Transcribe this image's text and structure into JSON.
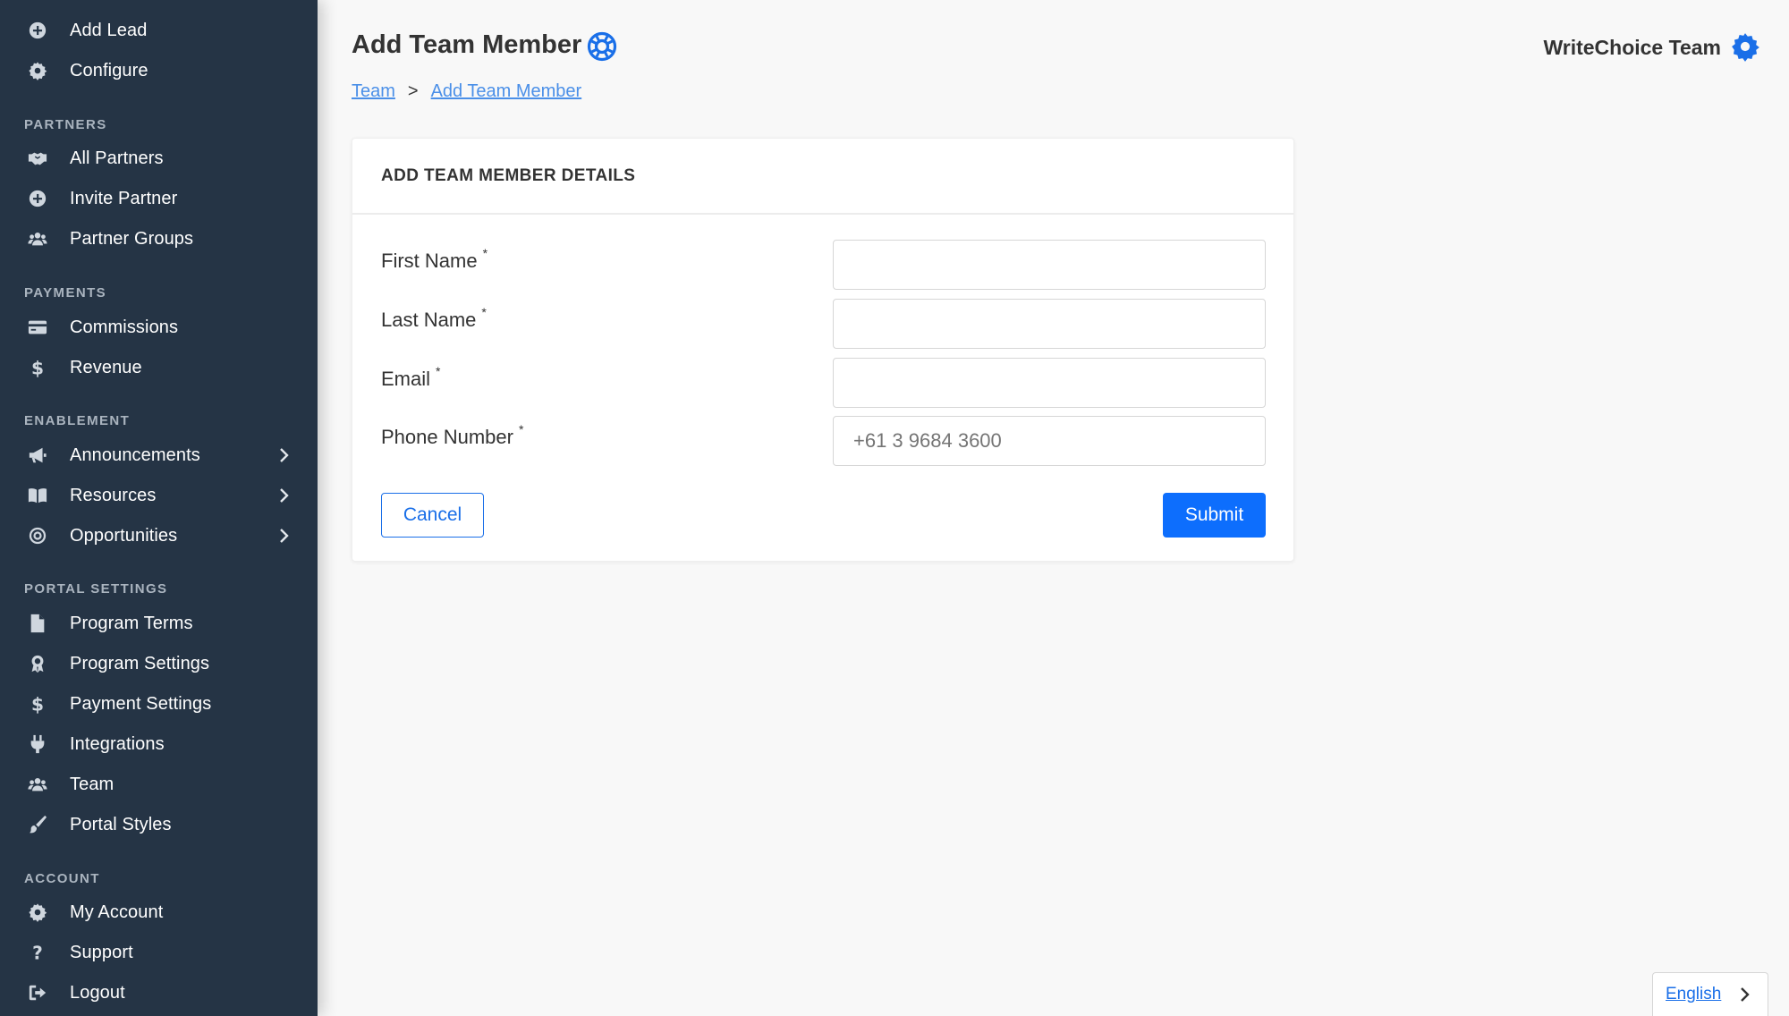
{
  "sidebar": {
    "top_items": [
      {
        "label": "Add Lead",
        "icon": "plus-circle-icon"
      },
      {
        "label": "Configure",
        "icon": "gear-icon"
      }
    ],
    "sections": {
      "partners": {
        "title": "PARTNERS",
        "items": [
          {
            "label": "All Partners",
            "icon": "handshake-icon"
          },
          {
            "label": "Invite Partner",
            "icon": "plus-circle-icon"
          },
          {
            "label": "Partner Groups",
            "icon": "users-icon"
          }
        ]
      },
      "payments": {
        "title": "PAYMENTS",
        "items": [
          {
            "label": "Commissions",
            "icon": "credit-card-icon"
          },
          {
            "label": "Revenue",
            "icon": "dollar-icon"
          }
        ]
      },
      "enablement": {
        "title": "ENABLEMENT",
        "items": [
          {
            "label": "Announcements",
            "icon": "megaphone-icon"
          },
          {
            "label": "Resources",
            "icon": "book-icon"
          },
          {
            "label": "Opportunities",
            "icon": "target-icon"
          }
        ]
      },
      "portal_settings": {
        "title": "PORTAL SETTINGS",
        "items": [
          {
            "label": "Program Terms",
            "icon": "file-icon"
          },
          {
            "label": "Program Settings",
            "icon": "award-icon"
          },
          {
            "label": "Payment Settings",
            "icon": "dollar-icon"
          },
          {
            "label": "Integrations",
            "icon": "plug-icon"
          },
          {
            "label": "Team",
            "icon": "users-icon"
          },
          {
            "label": "Portal Styles",
            "icon": "brush-icon"
          }
        ]
      },
      "account": {
        "title": "ACCOUNT",
        "items": [
          {
            "label": "My Account",
            "icon": "gear-icon"
          },
          {
            "label": "Support",
            "icon": "question-icon"
          },
          {
            "label": "Logout",
            "icon": "logout-icon"
          }
        ]
      }
    }
  },
  "header": {
    "title": "Add Team Member",
    "team_name": "WriteChoice Team",
    "accent_color": "#1a6fe8"
  },
  "breadcrumb": {
    "items": [
      "Team",
      "Add Team Member"
    ],
    "separator": ">"
  },
  "form": {
    "card_title": "ADD TEAM MEMBER DETAILS",
    "required_mark": "*",
    "fields": [
      {
        "label": "First Name",
        "value": "",
        "placeholder": ""
      },
      {
        "label": "Last Name",
        "value": "",
        "placeholder": ""
      },
      {
        "label": "Email",
        "value": "",
        "placeholder": ""
      },
      {
        "label": "Phone Number",
        "value": "",
        "placeholder": "+61 3 9684 3600"
      }
    ],
    "cancel_label": "Cancel",
    "submit_label": "Submit"
  },
  "language": {
    "selected": "English"
  }
}
